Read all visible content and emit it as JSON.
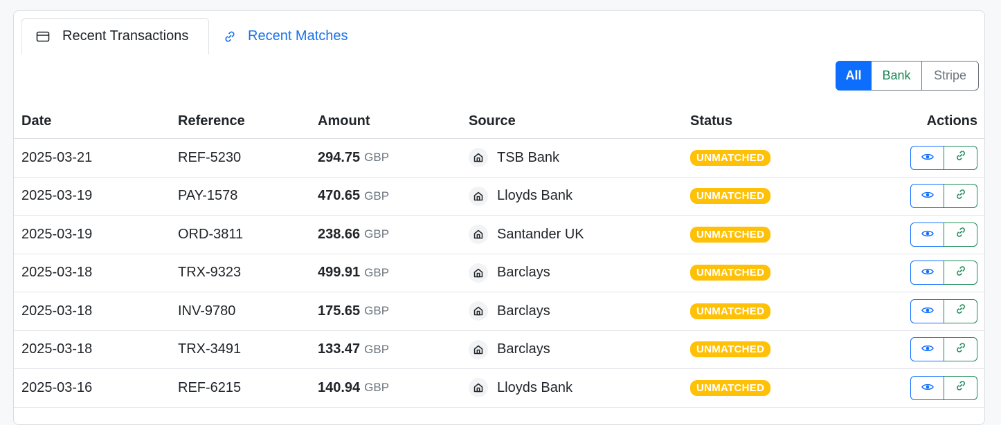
{
  "tabs": {
    "transactions": {
      "label": "Recent Transactions",
      "icon": "credit-card-icon"
    },
    "matches": {
      "label": "Recent Matches",
      "icon": "link-icon"
    }
  },
  "filters": {
    "all": "All",
    "bank": "Bank",
    "stripe": "Stripe",
    "selected": "All"
  },
  "table": {
    "headers": {
      "date": "Date",
      "reference": "Reference",
      "amount": "Amount",
      "source": "Source",
      "status": "Status",
      "actions": "Actions"
    },
    "rows": [
      {
        "date": "2025-03-21",
        "reference": "REF-5230",
        "amount": "294.75",
        "currency": "GBP",
        "source": "TSB Bank",
        "status": "UNMATCHED"
      },
      {
        "date": "2025-03-19",
        "reference": "PAY-1578",
        "amount": "470.65",
        "currency": "GBP",
        "source": "Lloyds Bank",
        "status": "UNMATCHED"
      },
      {
        "date": "2025-03-19",
        "reference": "ORD-3811",
        "amount": "238.66",
        "currency": "GBP",
        "source": "Santander UK",
        "status": "UNMATCHED"
      },
      {
        "date": "2025-03-18",
        "reference": "TRX-9323",
        "amount": "499.91",
        "currency": "GBP",
        "source": "Barclays",
        "status": "UNMATCHED"
      },
      {
        "date": "2025-03-18",
        "reference": "INV-9780",
        "amount": "175.65",
        "currency": "GBP",
        "source": "Barclays",
        "status": "UNMATCHED"
      },
      {
        "date": "2025-03-18",
        "reference": "TRX-3491",
        "amount": "133.47",
        "currency": "GBP",
        "source": "Barclays",
        "status": "UNMATCHED"
      },
      {
        "date": "2025-03-16",
        "reference": "REF-6215",
        "amount": "140.94",
        "currency": "GBP",
        "source": "Lloyds Bank",
        "status": "UNMATCHED"
      }
    ]
  },
  "colors": {
    "primary": "#0d6efd",
    "success": "#198754",
    "warning": "#ffc107",
    "muted": "#6c757d"
  }
}
